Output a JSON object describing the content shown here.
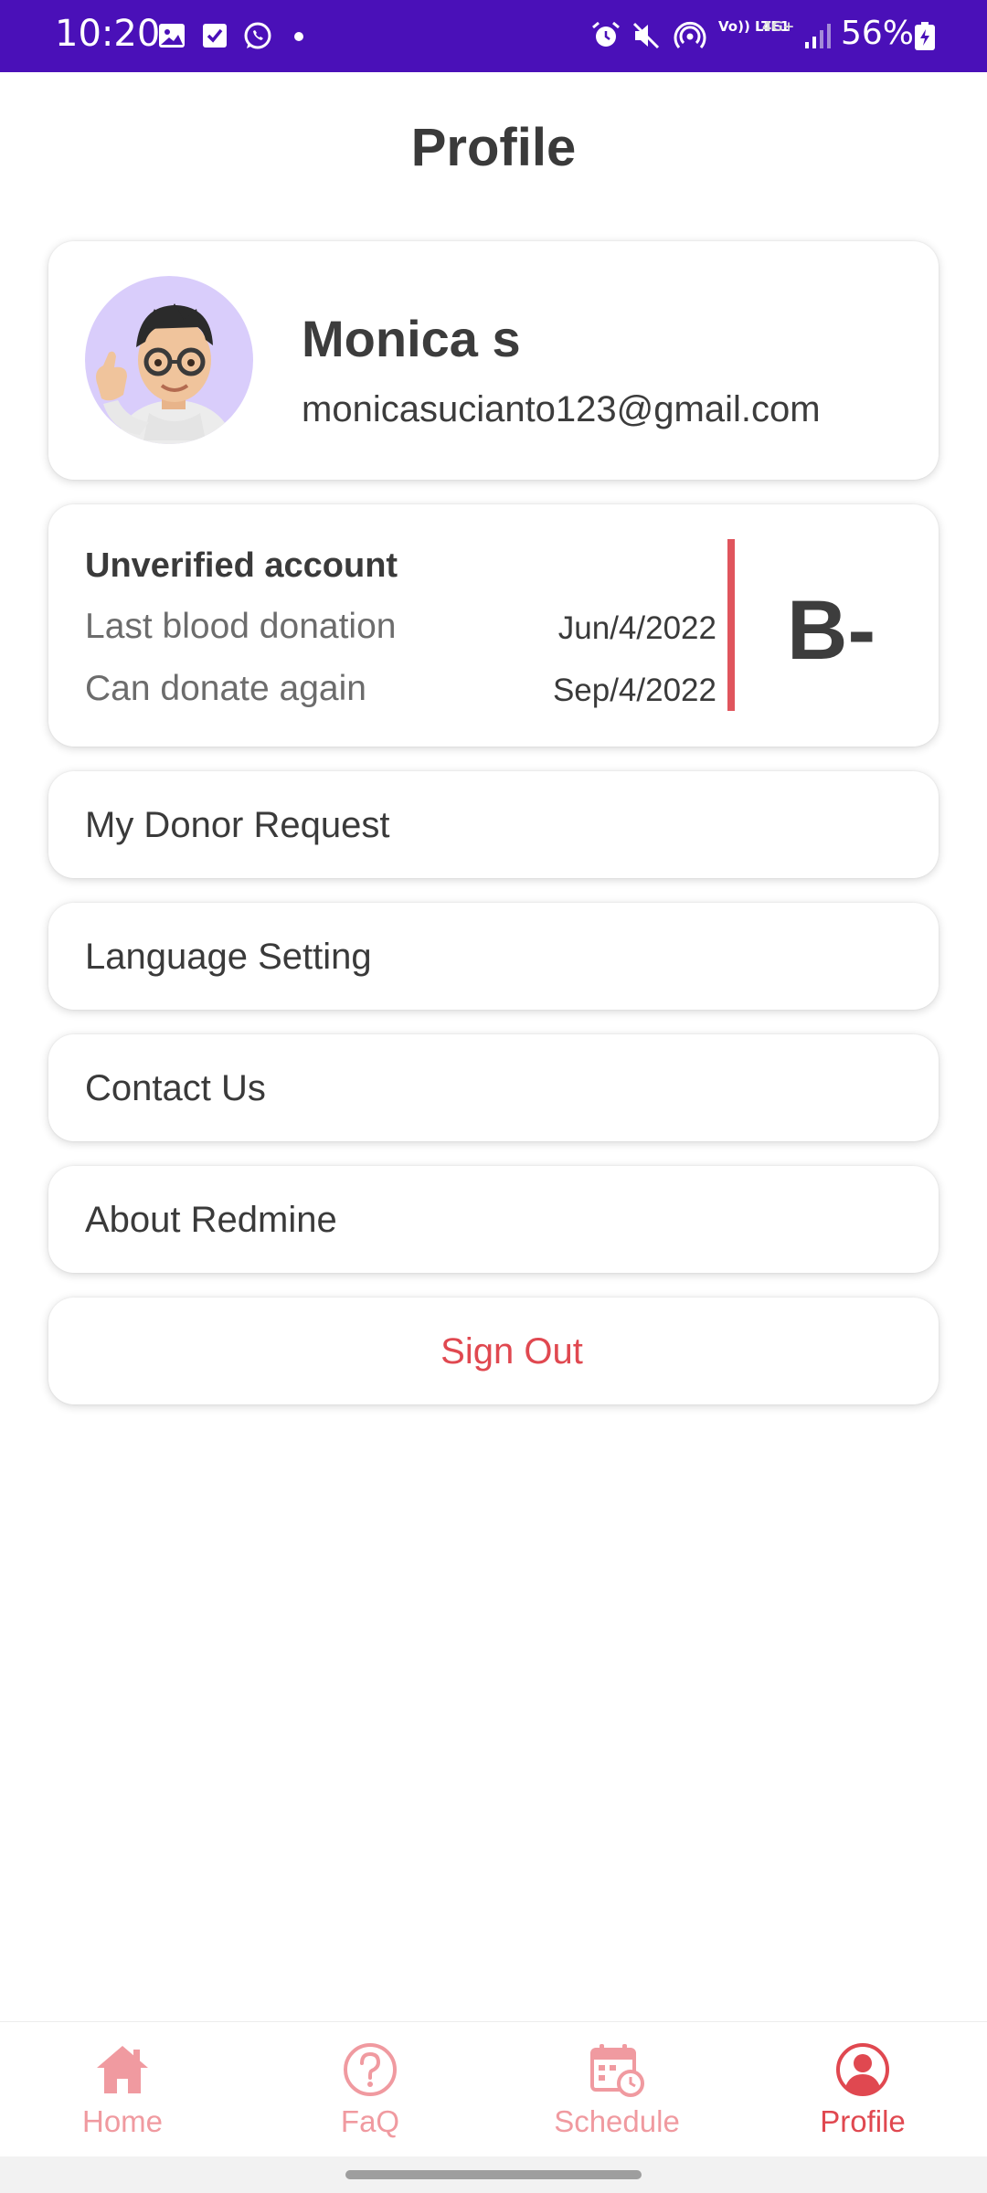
{
  "status_bar": {
    "time": "10:20",
    "battery": "56%",
    "network_volte": "Vo)) LTE1",
    "network_4g": "4G+",
    "icons": [
      "gallery-icon",
      "checkbox-icon",
      "whatsapp-icon",
      "alarm-icon",
      "mute-icon",
      "hotspot-icon",
      "signal-icon",
      "battery-charging-icon"
    ]
  },
  "header": {
    "title": "Profile"
  },
  "profile": {
    "name": "Monica s",
    "email": "monicasucianto123@gmail.com"
  },
  "donation_status": {
    "title": "Unverified account",
    "last_donation_label": "Last blood donation",
    "last_donation_date": "Jun/4/2022",
    "next_donation_label": "Can donate again",
    "next_donation_date": "Sep/4/2022",
    "blood_type": "B-"
  },
  "menu": {
    "items": [
      {
        "label": "My Donor Request"
      },
      {
        "label": "Language Setting"
      },
      {
        "label": "Contact Us"
      },
      {
        "label": "About Redmine"
      }
    ],
    "sign_out": "Sign Out"
  },
  "bottom_nav": {
    "items": [
      {
        "label": "Home",
        "icon": "home-icon"
      },
      {
        "label": "FaQ",
        "icon": "question-circle-icon"
      },
      {
        "label": "Schedule",
        "icon": "calendar-clock-icon"
      },
      {
        "label": "Profile",
        "icon": "user-circle-icon",
        "active": true
      }
    ]
  },
  "colors": {
    "status_bar": "#4a10b8",
    "accent_red": "#e04850",
    "inactive_nav": "#f09aa0",
    "avatar_bg": "#d9cdfb"
  }
}
